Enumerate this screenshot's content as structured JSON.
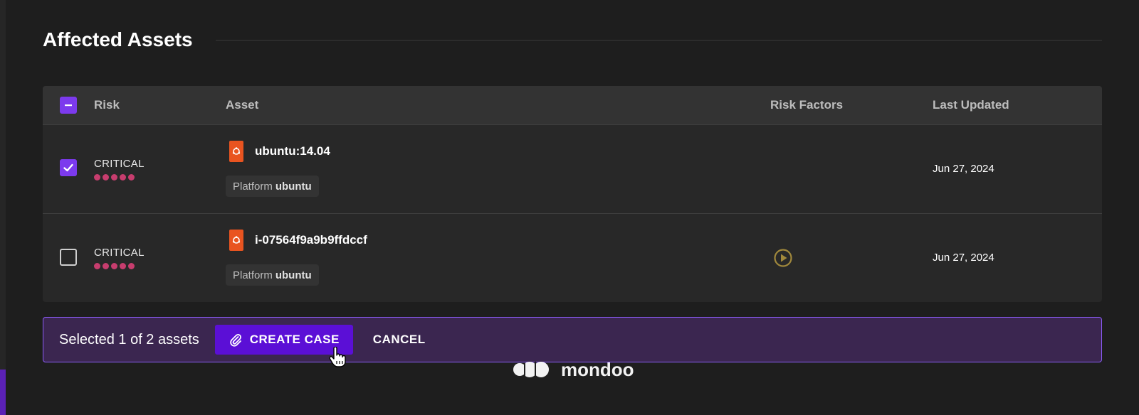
{
  "section": {
    "title": "Affected Assets"
  },
  "table": {
    "headers": {
      "risk": "Risk",
      "asset": "Asset",
      "risk_factors": "Risk Factors",
      "last_updated": "Last Updated"
    },
    "select_all_state": "indeterminate",
    "rows": [
      {
        "selected": true,
        "risk": "CRITICAL",
        "risk_level_dots": 5,
        "asset_icon": "ubuntu-icon",
        "asset_name": "ubuntu:14.04",
        "tag_key": "Platform",
        "tag_value": "ubuntu",
        "risk_factor_icon": "",
        "last_updated": "Jun 27, 2024"
      },
      {
        "selected": false,
        "risk": "CRITICAL",
        "risk_level_dots": 5,
        "asset_icon": "ubuntu-icon",
        "asset_name": "i-07564f9a9b9ffdccf",
        "tag_key": "Platform",
        "tag_value": "ubuntu",
        "risk_factor_icon": "play-circle-icon",
        "last_updated": "Jun 27, 2024"
      }
    ]
  },
  "action_bar": {
    "selection_text": "Selected 1 of 2 assets",
    "create_label": "CREATE CASE",
    "cancel_label": "CANCEL"
  },
  "footer": {
    "logo_text": "mondoo"
  },
  "colors": {
    "accent": "#7c3aed",
    "critical": "#c73d6e",
    "ubuntu": "#e95420",
    "risk_factor": "#a0883c"
  }
}
